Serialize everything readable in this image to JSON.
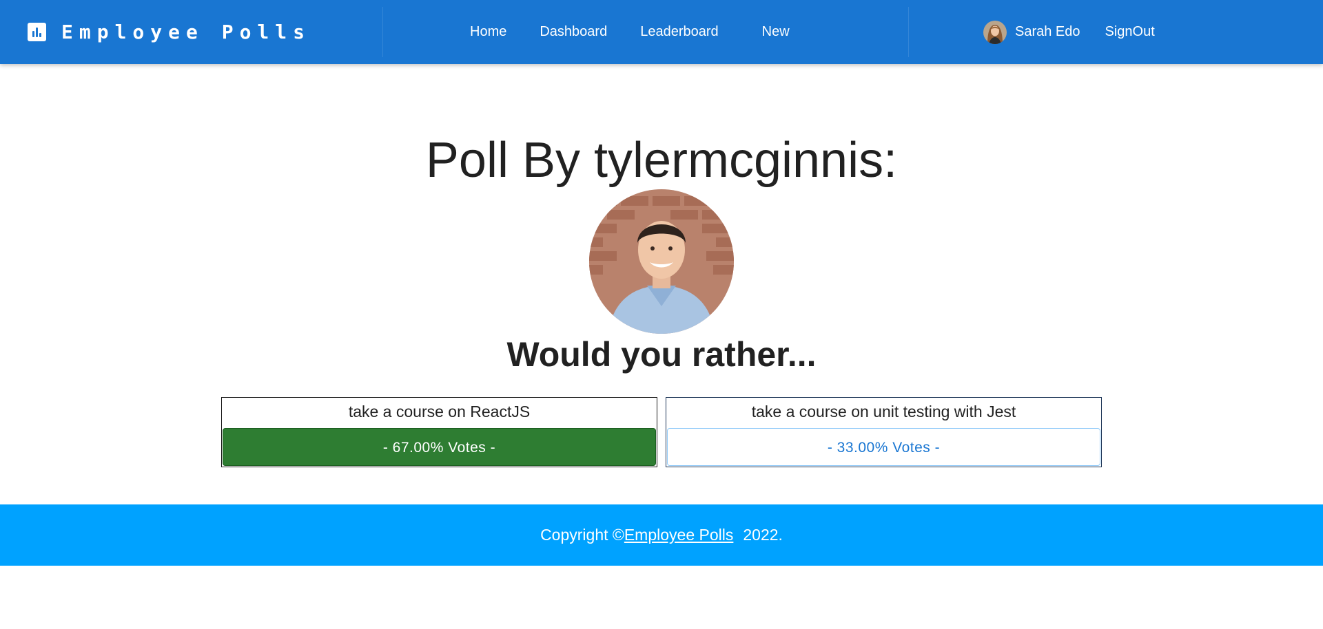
{
  "header": {
    "brand": "Employee Polls",
    "brand_icon": "bar-chart-icon",
    "nav": [
      "Home",
      "Dashboard",
      "Leaderboard",
      "New"
    ],
    "user_name": "Sarah Edo",
    "signout_label": "SignOut"
  },
  "poll": {
    "title": "Poll By tylermcginnis:",
    "question": "Would you rather...",
    "options": [
      {
        "text": "take a course on ReactJS",
        "votes": "- 67.00% Votes -",
        "percent": 67.0
      },
      {
        "text": "take a course on unit testing with Jest",
        "votes": "- 33.00% Votes -",
        "percent": 33.0
      }
    ]
  },
  "footer": {
    "prefix": "Copyright ©",
    "link": " Employee Polls",
    "year": "2022."
  },
  "colors": {
    "header": "#1976d2",
    "footer": "#00a2ff",
    "chosen": "#2e7d32",
    "other_text": "#1976d2"
  }
}
